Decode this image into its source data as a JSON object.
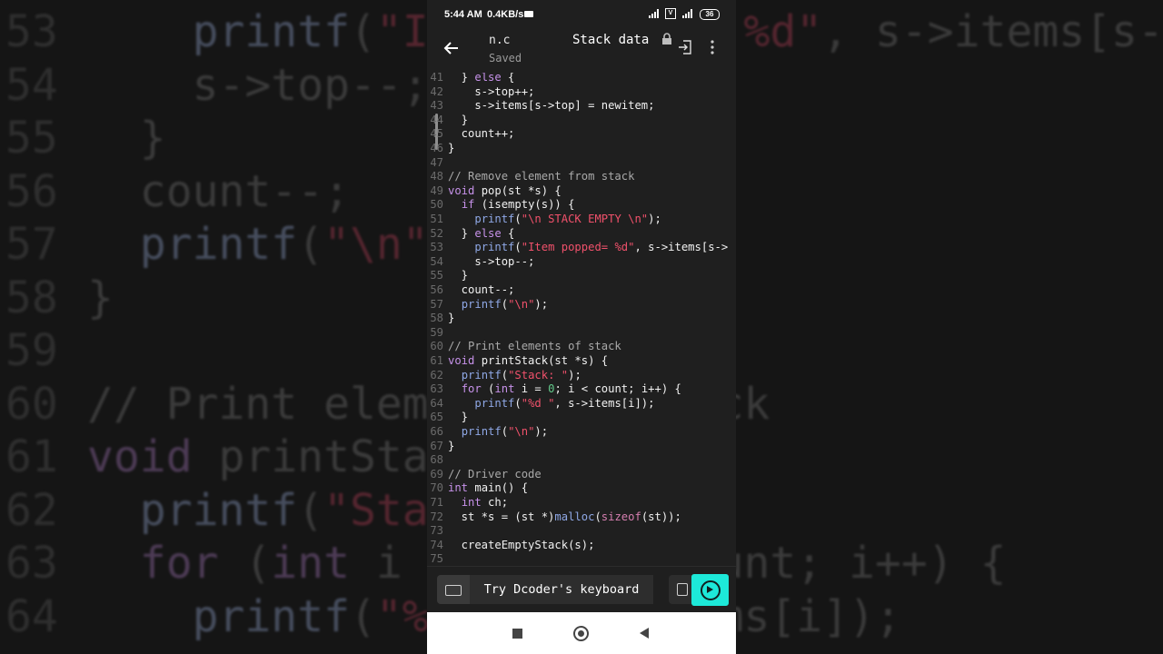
{
  "background_zoom": {
    "lines": [
      {
        "n": "53",
        "parts": [
          {
            "t": "    ",
            "c": ""
          },
          {
            "t": "printf",
            "c": "fn"
          },
          {
            "t": "(",
            "c": ""
          },
          {
            "t": "\"Item popped= %d\"",
            "c": "str"
          },
          {
            "t": ", s->items[s->",
            "c": ""
          }
        ]
      },
      {
        "n": "54",
        "parts": [
          {
            "t": "    s->top--;",
            "c": ""
          }
        ]
      },
      {
        "n": "55",
        "parts": [
          {
            "t": "  }",
            "c": ""
          }
        ]
      },
      {
        "n": "56",
        "parts": [
          {
            "t": "  count--;",
            "c": ""
          }
        ]
      },
      {
        "n": "57",
        "parts": [
          {
            "t": "  ",
            "c": ""
          },
          {
            "t": "printf",
            "c": "fn"
          },
          {
            "t": "(",
            "c": ""
          },
          {
            "t": "\"\\n\"",
            "c": "str"
          },
          {
            "t": ");",
            "c": ""
          }
        ]
      },
      {
        "n": "58",
        "parts": [
          {
            "t": "}",
            "c": ""
          }
        ]
      },
      {
        "n": "59",
        "parts": [
          {
            "t": "",
            "c": ""
          }
        ]
      },
      {
        "n": "60",
        "parts": [
          {
            "t": "// Print elements of stack",
            "c": ""
          }
        ]
      },
      {
        "n": "61",
        "parts": [
          {
            "t": "void",
            "c": "kw"
          },
          {
            "t": " printStack(st *s) {",
            "c": ""
          }
        ]
      },
      {
        "n": "62",
        "parts": [
          {
            "t": "  ",
            "c": ""
          },
          {
            "t": "printf",
            "c": "fn"
          },
          {
            "t": "(",
            "c": ""
          },
          {
            "t": "\"Stack: \"",
            "c": "str"
          },
          {
            "t": ");",
            "c": ""
          }
        ]
      },
      {
        "n": "63",
        "parts": [
          {
            "t": "  ",
            "c": ""
          },
          {
            "t": "for",
            "c": "kw"
          },
          {
            "t": " (",
            "c": ""
          },
          {
            "t": "int",
            "c": "kw"
          },
          {
            "t": " i = 0; i < count; i++) {",
            "c": ""
          }
        ]
      },
      {
        "n": "64",
        "parts": [
          {
            "t": "    ",
            "c": ""
          },
          {
            "t": "printf",
            "c": "fn"
          },
          {
            "t": "(",
            "c": ""
          },
          {
            "t": "\"%d \"",
            "c": "str"
          },
          {
            "t": ", s->items[i]);",
            "c": ""
          }
        ]
      }
    ]
  },
  "status_bar": {
    "time": "5:44 AM",
    "speed": "0.4KB/s",
    "battery": "36"
  },
  "app_bar": {
    "file_name": "n.c",
    "saved_label": "Saved",
    "title": "Stack data"
  },
  "code_lines": [
    {
      "n": "41",
      "parts": [
        {
          "t": "  } ",
          "c": ""
        },
        {
          "t": "else",
          "c": "kw"
        },
        {
          "t": " {",
          "c": ""
        }
      ]
    },
    {
      "n": "42",
      "parts": [
        {
          "t": "    s->top++;",
          "c": ""
        }
      ]
    },
    {
      "n": "43",
      "parts": [
        {
          "t": "    s->items[s->top] = newitem;",
          "c": ""
        }
      ]
    },
    {
      "n": "44",
      "parts": [
        {
          "t": "  }",
          "c": ""
        }
      ]
    },
    {
      "n": "45",
      "parts": [
        {
          "t": "  count++;",
          "c": ""
        }
      ]
    },
    {
      "n": "46",
      "parts": [
        {
          "t": "}",
          "c": ""
        }
      ]
    },
    {
      "n": "47",
      "parts": [
        {
          "t": "",
          "c": ""
        }
      ]
    },
    {
      "n": "48",
      "parts": [
        {
          "t": "// Remove element from stack",
          "c": "com"
        }
      ]
    },
    {
      "n": "49",
      "parts": [
        {
          "t": "void",
          "c": "kw"
        },
        {
          "t": " pop(st *s) {",
          "c": ""
        }
      ]
    },
    {
      "n": "50",
      "parts": [
        {
          "t": "  ",
          "c": ""
        },
        {
          "t": "if",
          "c": "kw"
        },
        {
          "t": " (isempty(s)) {",
          "c": ""
        }
      ]
    },
    {
      "n": "51",
      "parts": [
        {
          "t": "    ",
          "c": ""
        },
        {
          "t": "printf",
          "c": "fn"
        },
        {
          "t": "(",
          "c": ""
        },
        {
          "t": "\"\\n STACK EMPTY \\n\"",
          "c": "str"
        },
        {
          "t": ");",
          "c": ""
        }
      ]
    },
    {
      "n": "52",
      "parts": [
        {
          "t": "  } ",
          "c": ""
        },
        {
          "t": "else",
          "c": "kw"
        },
        {
          "t": " {",
          "c": ""
        }
      ]
    },
    {
      "n": "53",
      "parts": [
        {
          "t": "    ",
          "c": ""
        },
        {
          "t": "printf",
          "c": "fn"
        },
        {
          "t": "(",
          "c": ""
        },
        {
          "t": "\"Item popped= %d\"",
          "c": "str"
        },
        {
          "t": ", s->items[s->",
          "c": ""
        }
      ]
    },
    {
      "n": "54",
      "parts": [
        {
          "t": "    s->top--;",
          "c": ""
        }
      ]
    },
    {
      "n": "55",
      "parts": [
        {
          "t": "  }",
          "c": ""
        }
      ]
    },
    {
      "n": "56",
      "parts": [
        {
          "t": "  count--;",
          "c": ""
        }
      ]
    },
    {
      "n": "57",
      "parts": [
        {
          "t": "  ",
          "c": ""
        },
        {
          "t": "printf",
          "c": "fn"
        },
        {
          "t": "(",
          "c": ""
        },
        {
          "t": "\"\\n\"",
          "c": "str"
        },
        {
          "t": ");",
          "c": ""
        }
      ]
    },
    {
      "n": "58",
      "parts": [
        {
          "t": "}",
          "c": ""
        }
      ]
    },
    {
      "n": "59",
      "parts": [
        {
          "t": "",
          "c": ""
        }
      ]
    },
    {
      "n": "60",
      "parts": [
        {
          "t": "// Print elements of stack",
          "c": "com"
        }
      ]
    },
    {
      "n": "61",
      "parts": [
        {
          "t": "void",
          "c": "kw"
        },
        {
          "t": " printStack(st *s) {",
          "c": ""
        }
      ]
    },
    {
      "n": "62",
      "parts": [
        {
          "t": "  ",
          "c": ""
        },
        {
          "t": "printf",
          "c": "fn"
        },
        {
          "t": "(",
          "c": ""
        },
        {
          "t": "\"Stack: \"",
          "c": "str"
        },
        {
          "t": ");",
          "c": ""
        }
      ]
    },
    {
      "n": "63",
      "parts": [
        {
          "t": "  ",
          "c": ""
        },
        {
          "t": "for",
          "c": "kw"
        },
        {
          "t": " (",
          "c": ""
        },
        {
          "t": "int",
          "c": "kw"
        },
        {
          "t": " i = ",
          "c": ""
        },
        {
          "t": "0",
          "c": "num"
        },
        {
          "t": "; i < count; i++) {",
          "c": ""
        }
      ]
    },
    {
      "n": "64",
      "parts": [
        {
          "t": "    ",
          "c": ""
        },
        {
          "t": "printf",
          "c": "fn"
        },
        {
          "t": "(",
          "c": ""
        },
        {
          "t": "\"%d \"",
          "c": "str"
        },
        {
          "t": ", s->items[i]);",
          "c": ""
        }
      ]
    },
    {
      "n": "65",
      "parts": [
        {
          "t": "  }",
          "c": ""
        }
      ]
    },
    {
      "n": "66",
      "parts": [
        {
          "t": "  ",
          "c": ""
        },
        {
          "t": "printf",
          "c": "fn"
        },
        {
          "t": "(",
          "c": ""
        },
        {
          "t": "\"\\n\"",
          "c": "str"
        },
        {
          "t": ");",
          "c": ""
        }
      ]
    },
    {
      "n": "67",
      "parts": [
        {
          "t": "}",
          "c": ""
        }
      ]
    },
    {
      "n": "68",
      "parts": [
        {
          "t": "",
          "c": ""
        }
      ]
    },
    {
      "n": "69",
      "parts": [
        {
          "t": "// Driver code",
          "c": "com"
        }
      ]
    },
    {
      "n": "70",
      "parts": [
        {
          "t": "int",
          "c": "kw"
        },
        {
          "t": " main() {",
          "c": ""
        }
      ]
    },
    {
      "n": "71",
      "parts": [
        {
          "t": "  ",
          "c": ""
        },
        {
          "t": "int",
          "c": "kw"
        },
        {
          "t": " ch;",
          "c": ""
        }
      ]
    },
    {
      "n": "72",
      "parts": [
        {
          "t": "  st *s = (st *)",
          "c": ""
        },
        {
          "t": "malloc",
          "c": "fn"
        },
        {
          "t": "(",
          "c": ""
        },
        {
          "t": "sizeof",
          "c": "kw2"
        },
        {
          "t": "(st));",
          "c": ""
        }
      ]
    },
    {
      "n": "73",
      "parts": [
        {
          "t": "",
          "c": ""
        }
      ]
    },
    {
      "n": "74",
      "parts": [
        {
          "t": "  createEmptyStack(s);",
          "c": ""
        }
      ]
    },
    {
      "n": "75",
      "parts": [
        {
          "t": "",
          "c": ""
        }
      ]
    }
  ],
  "bottom_bar": {
    "keyboard_prompt": "Try Dcoder's keyboard"
  },
  "icons": {
    "back": "arrow-left-icon",
    "lock": "lock-icon",
    "exit": "exit-icon",
    "more": "more-vert-icon",
    "keyboard": "keyboard-icon",
    "snippet": "snippet-icon",
    "run": "play-circle-icon",
    "nav_recent": "square-icon",
    "nav_home": "circle-icon",
    "nav_back": "triangle-back-icon"
  },
  "colors": {
    "accent": "#1de9d9",
    "keyword": "#c792ea",
    "string": "#f0516b",
    "function": "#8fa8e6",
    "number": "#62c98a"
  }
}
